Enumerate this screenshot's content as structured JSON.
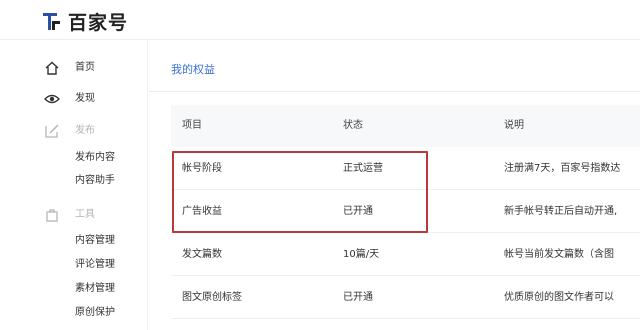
{
  "brand": {
    "name": "百家号"
  },
  "sidebar": {
    "items": [
      {
        "label": "首页",
        "icon": "home-icon"
      },
      {
        "label": "发现",
        "icon": "eye-icon"
      },
      {
        "label": "发布",
        "icon": "edit-icon"
      },
      {
        "label": "工具",
        "icon": "tools-icon"
      }
    ],
    "publish_sub": [
      "发布内容",
      "内容助手"
    ],
    "tools_sub": [
      "内容管理",
      "评论管理",
      "素材管理",
      "原创保护"
    ]
  },
  "main": {
    "tab_label": "我的权益",
    "table": {
      "headers": [
        "项目",
        "状态",
        "说明"
      ],
      "rows": [
        [
          "帐号阶段",
          "正式运营",
          "注册满7天，百家号指数达"
        ],
        [
          "广告收益",
          "已开通",
          "新手帐号转正后自动开通,"
        ],
        [
          "发文篇数",
          "10篇/天",
          "帐号当前发文篇数（含图"
        ],
        [
          "图文原创标签",
          "已开通",
          "优质原创的图文作者可以"
        ]
      ]
    }
  },
  "colors": {
    "accent": "#3b6fd6",
    "highlight": "#b7393a",
    "header_bg": "#f7f8fa"
  }
}
